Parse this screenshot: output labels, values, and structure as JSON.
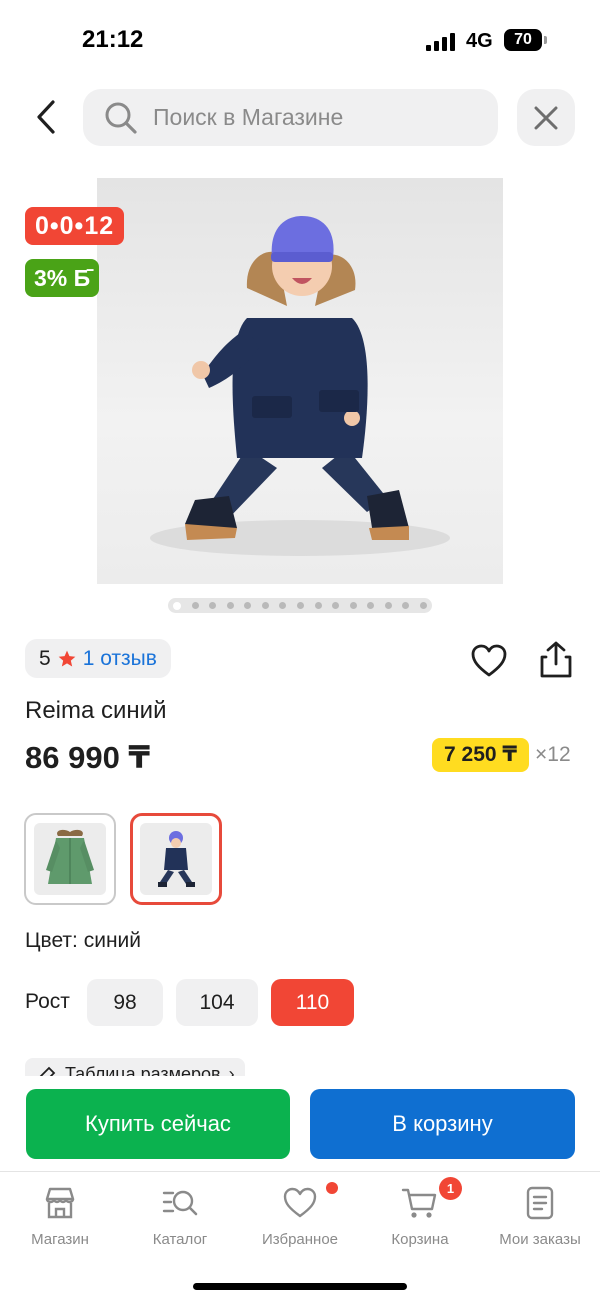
{
  "status_bar": {
    "time": "21:12",
    "network": "4G",
    "battery": "70"
  },
  "search": {
    "placeholder": "Поиск в Магазине"
  },
  "badges": {
    "installment": "0•0•12",
    "bonus": "3% Б̄"
  },
  "gallery": {
    "dots_total": 15,
    "active_index": 0
  },
  "rating": {
    "value": "5",
    "reviews_link": "1 отзыв"
  },
  "product": {
    "title": "Reima синий",
    "price": "86 990 ₸",
    "monthly_payment": "7 250 ₸",
    "monthly_multiplier": "×12"
  },
  "variants": {
    "color_label": "Цвет: синий",
    "items": [
      {
        "name": "green"
      },
      {
        "name": "blue",
        "selected": true
      }
    ]
  },
  "sizes": {
    "label": "Рост",
    "options": [
      "98",
      "104",
      "110"
    ],
    "selected": "110"
  },
  "size_table": {
    "label": "Таблица размеров"
  },
  "actions": {
    "buy_now": "Купить сейчас",
    "add_to_cart": "В корзину"
  },
  "bottom_nav": {
    "items": [
      {
        "label": "Магазин",
        "icon": "store-icon"
      },
      {
        "label": "Каталог",
        "icon": "catalog-search-icon"
      },
      {
        "label": "Избранное",
        "icon": "heart-icon"
      },
      {
        "label": "Корзина",
        "icon": "cart-icon",
        "badge": "1"
      },
      {
        "label": "Мои заказы",
        "icon": "orders-icon"
      }
    ]
  },
  "colors": {
    "accent_red": "#f14635",
    "bonus_green": "#4aa317",
    "buy_green": "#0bb24f",
    "cart_blue": "#0f6fd1",
    "installment_yellow": "#ffdc20"
  }
}
